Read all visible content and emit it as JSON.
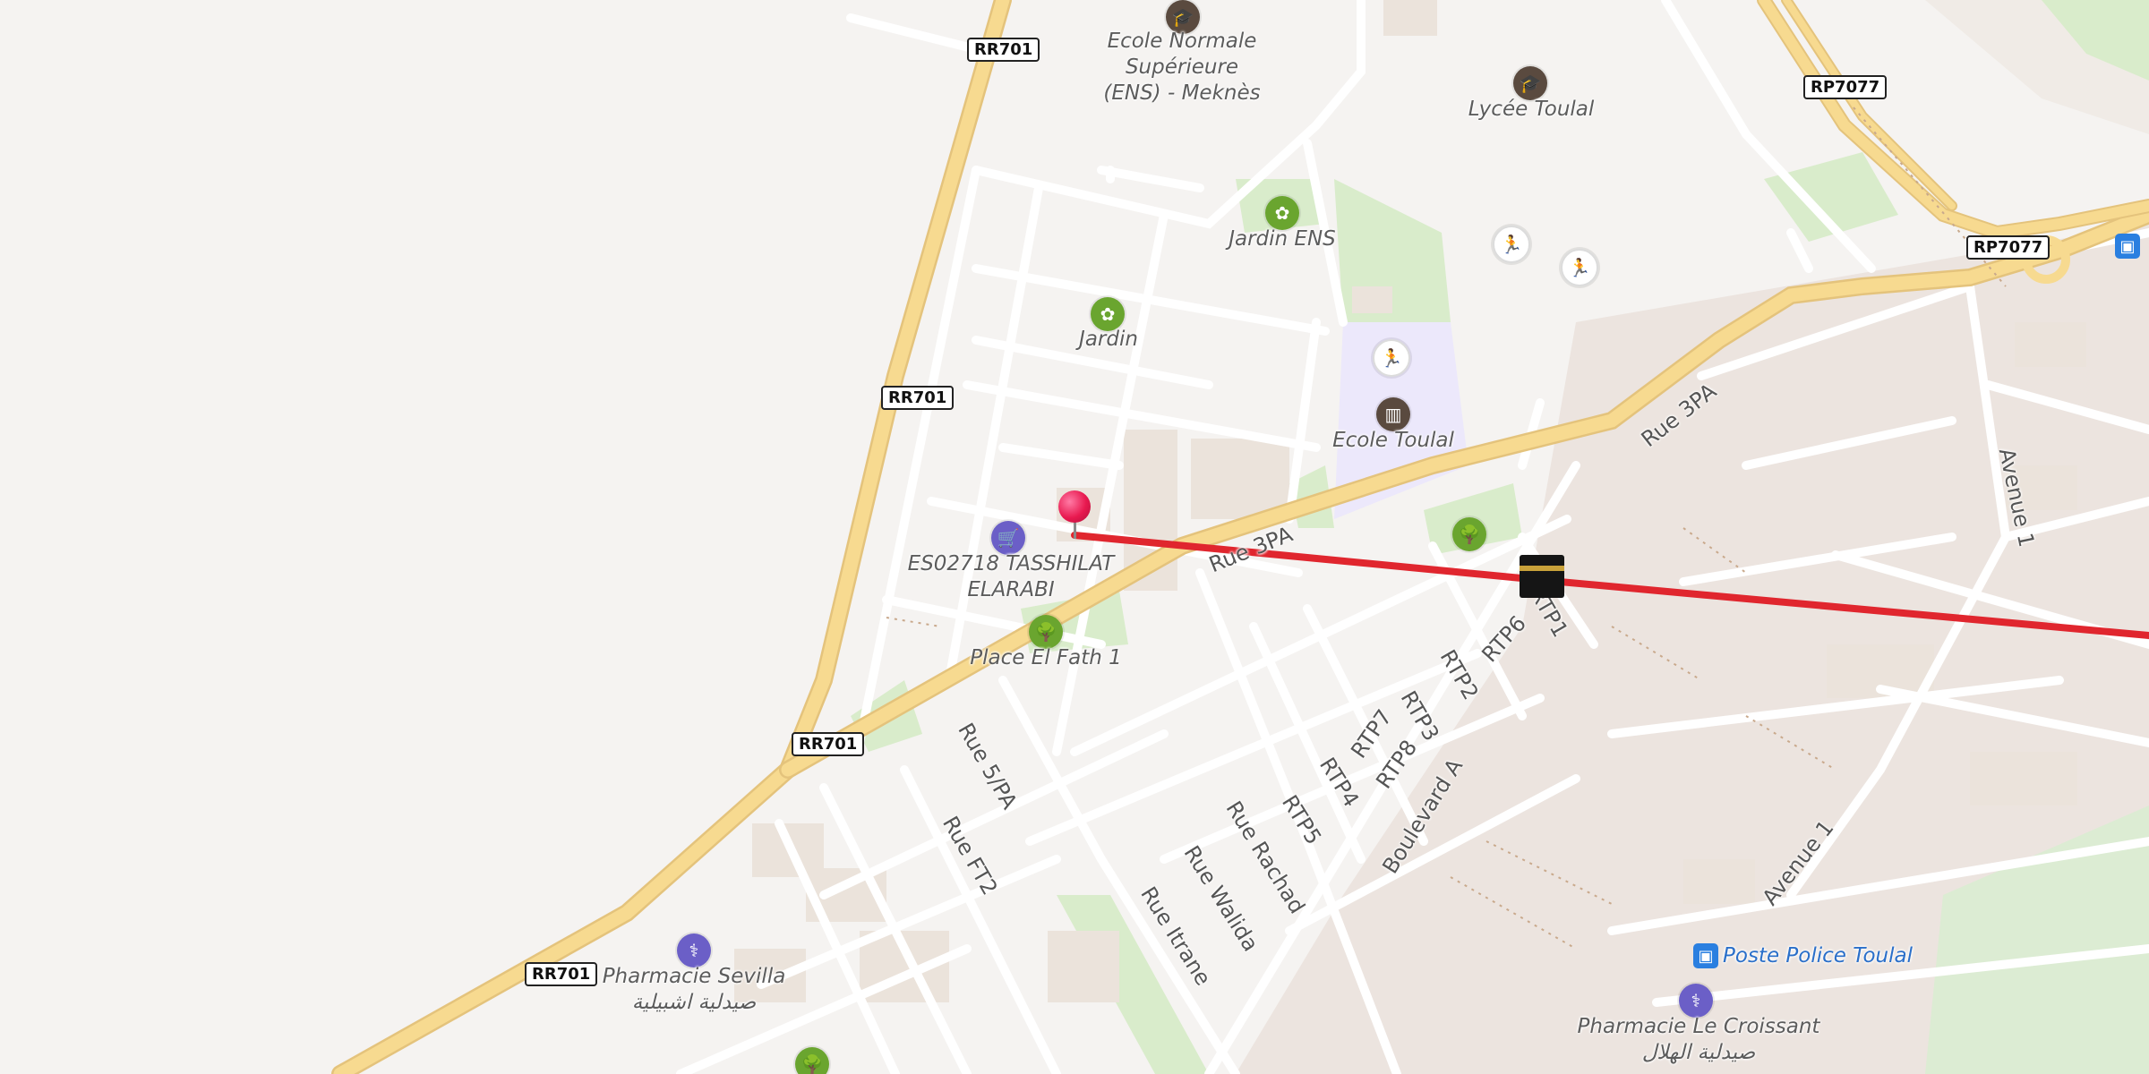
{
  "map": {
    "route_color": "#e0262e",
    "road_major_color": "#f6d58a",
    "road_minor_color": "#ffffff",
    "land_color": "#f5f3f1",
    "park_color": "#cfe8bf",
    "school_zone_color": "#ece8fb"
  },
  "road_shields": [
    {
      "id": "rr701-top",
      "text": "RR701"
    },
    {
      "id": "rr701-mid",
      "text": "RR701"
    },
    {
      "id": "rr701-low",
      "text": "RR701"
    },
    {
      "id": "rr701-bottom",
      "text": "RR701"
    },
    {
      "id": "rp7077-top",
      "text": "RP7077"
    },
    {
      "id": "rp7077-right",
      "text": "RP7077"
    }
  ],
  "places": [
    {
      "id": "ens",
      "text": "Ecole Normale Supérieure\n(ENS) - Meknès",
      "icon": "graduation-cap-icon"
    },
    {
      "id": "lycee",
      "text": "Lycée Toulal",
      "icon": "graduation-cap-icon"
    },
    {
      "id": "jardin-ens",
      "text": "Jardin ENS",
      "icon": "garden-icon"
    },
    {
      "id": "jardin",
      "text": "Jardin",
      "icon": "garden-icon"
    },
    {
      "id": "ecole-toulal",
      "text": "Ecole Toulal",
      "icon": "school-icon"
    },
    {
      "id": "tasshilat",
      "text": "ES02718 TASSHILAT\nELARABI",
      "icon": "shopping-cart-icon"
    },
    {
      "id": "place-el-fath",
      "text": "Place El Fath 1",
      "icon": "tree-icon"
    },
    {
      "id": "pharmacie-sevilla",
      "text": "Pharmacie Sevilla\nصيدلية اشبيلية",
      "icon": "pharmacy-icon"
    },
    {
      "id": "poste-police",
      "text": "Poste Police Toulal",
      "icon": "bus-icon"
    },
    {
      "id": "pharmacie-croissant",
      "text": "Pharmacie Le Croissant\nصيدلية الهلال",
      "icon": "pharmacy-icon"
    }
  ],
  "streets": [
    {
      "id": "rue-3pa-east",
      "text": "Rue 3PA"
    },
    {
      "id": "rue-3pa-west",
      "text": "Rue 3PA"
    },
    {
      "id": "rue-5pa",
      "text": "Rue 5/PA"
    },
    {
      "id": "rue-ft2",
      "text": "Rue FT2"
    },
    {
      "id": "rue-walida",
      "text": "Rue Walida"
    },
    {
      "id": "rue-itrane",
      "text": "Rue Itrane"
    },
    {
      "id": "rue-rachad",
      "text": "Rue Rachad"
    },
    {
      "id": "boulevard-a",
      "text": "Boulevard A"
    },
    {
      "id": "avenue-1-north",
      "text": "Avenue 1"
    },
    {
      "id": "avenue-1-south",
      "text": "Avenue 1"
    },
    {
      "id": "rtp6",
      "text": "RTP6"
    },
    {
      "id": "rtp2",
      "text": "RTP2"
    },
    {
      "id": "rtp3",
      "text": "RTP3"
    },
    {
      "id": "rtp7",
      "text": "RTP7"
    },
    {
      "id": "rtp8",
      "text": "RTP8"
    },
    {
      "id": "rtp4",
      "text": "RTP4"
    },
    {
      "id": "rtp5",
      "text": "RTP5"
    },
    {
      "id": "rtp1",
      "text": "RTP1"
    }
  ],
  "markers": {
    "pin_color": "#e8194f",
    "destination_icon": "kaaba-icon"
  }
}
